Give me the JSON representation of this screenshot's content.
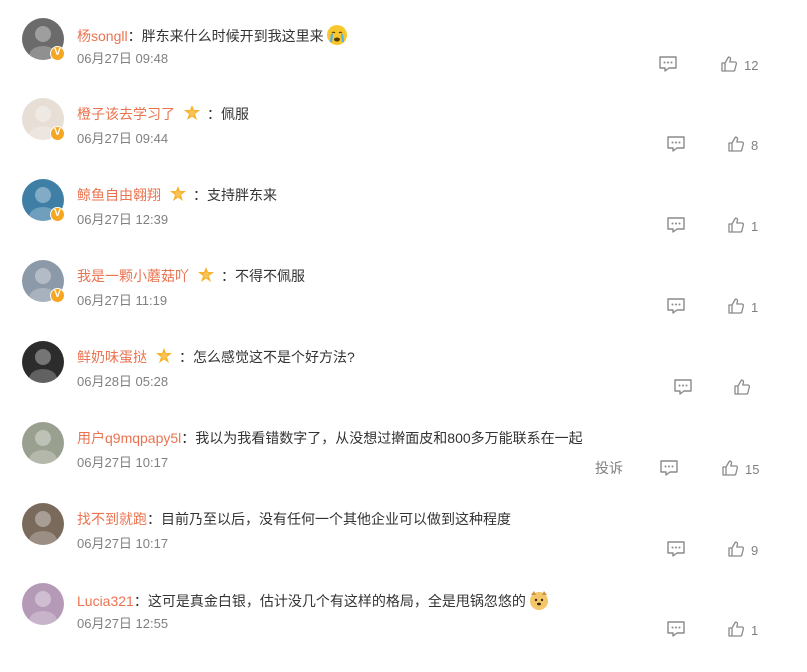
{
  "comments": [
    {
      "username": "杨songll",
      "text": "胖东来什么时候开到我这里来",
      "date": "06月27日 09:48",
      "likes": "12",
      "fan_badge": false,
      "emoji": "crying-face",
      "verified": true,
      "avatar_color": "#6b6b6b",
      "show_report": false
    },
    {
      "username": "橙子该去学习了",
      "text": "佩服",
      "date": "06月27日 09:44",
      "likes": "8",
      "fan_badge": true,
      "emoji": "",
      "verified": true,
      "avatar_color": "#e7ded6",
      "show_report": false
    },
    {
      "username": "鲸鱼自由翱翔",
      "text": "支持胖东来",
      "date": "06月27日 12:39",
      "likes": "1",
      "fan_badge": true,
      "emoji": "",
      "verified": true,
      "avatar_color": "#3f7fa6",
      "show_report": false
    },
    {
      "username": "我是一颗小蘑菇吖",
      "text": "不得不佩服",
      "date": "06月27日 11:19",
      "likes": "1",
      "fan_badge": true,
      "emoji": "",
      "verified": true,
      "avatar_color": "#8b99a8",
      "show_report": false
    },
    {
      "username": "鲜奶味蛋挞",
      "text": "怎么感觉这不是个好方法?",
      "date": "06月28日 05:28",
      "likes": "",
      "fan_badge": true,
      "emoji": "",
      "verified": false,
      "avatar_color": "#2c2c2c",
      "show_report": false
    },
    {
      "username": "用户q9mqpapy5l",
      "text": "我以为我看错数字了，从没想过擀面皮和800多万能联系在一起",
      "date": "06月27日 10:17",
      "likes": "15",
      "fan_badge": false,
      "emoji": "",
      "verified": false,
      "avatar_color": "#9aa08f",
      "show_report": true
    },
    {
      "username": "找不到就跑",
      "text": "目前乃至以后，没有任何一个其他企业可以做到这种程度",
      "date": "06月27日 10:17",
      "likes": "9",
      "fan_badge": false,
      "emoji": "",
      "verified": false,
      "avatar_color": "#7a6a5c",
      "show_report": false
    },
    {
      "username": "Lucia321",
      "text": "这可是真金白银，估计没几个有这样的格局，全是甩锅忽悠的",
      "date": "06月27日 12:55",
      "likes": "1",
      "fan_badge": false,
      "emoji": "dog-face",
      "verified": false,
      "avatar_color": "#b59ab8",
      "show_report": false
    }
  ],
  "labels": {
    "colon": "：",
    "report": "投诉"
  },
  "colors": {
    "username": "#eb7350",
    "meta": "#808080",
    "badge": "#f5a623"
  }
}
